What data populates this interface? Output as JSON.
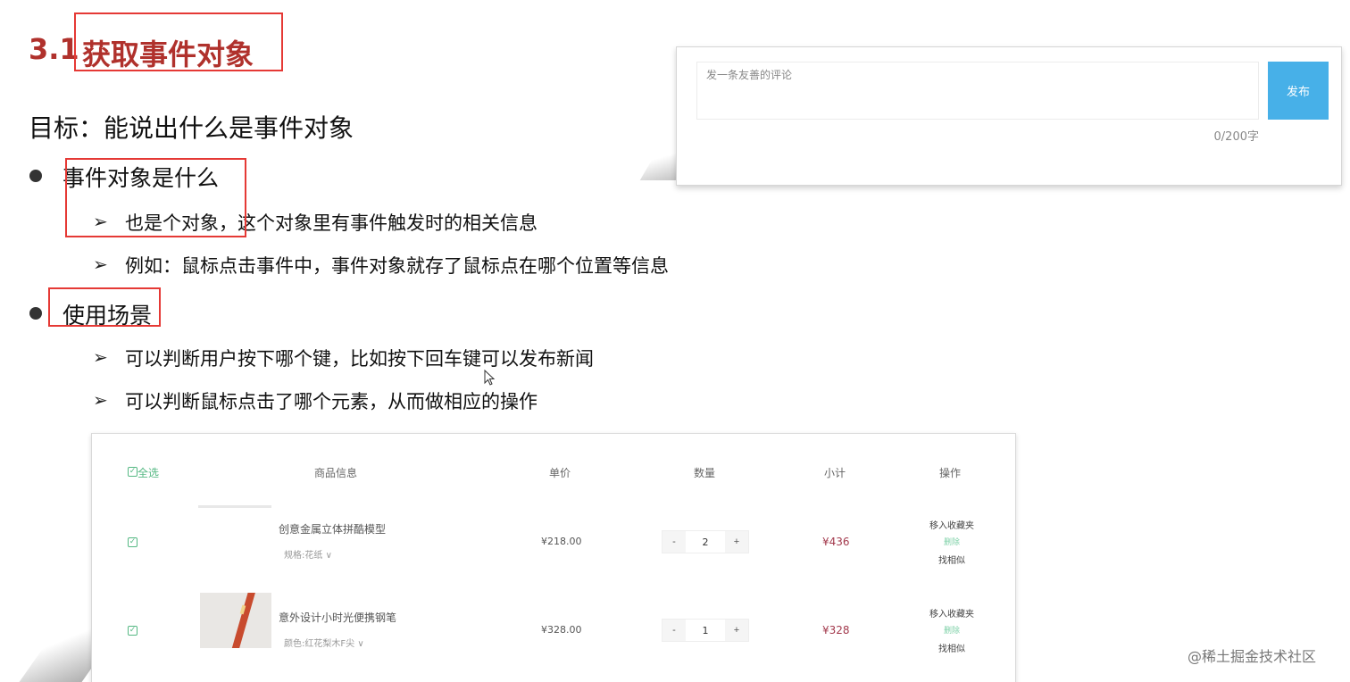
{
  "slide": {
    "title_number": "3.1",
    "title_text": "获取事件对象",
    "goal": "目标：能说出什么是事件对象",
    "bullets": [
      {
        "label": "事件对象是什么",
        "subs": [
          "也是个对象，这个对象里有事件触发时的相关信息",
          "例如：鼠标点击事件中，事件对象就存了鼠标点在哪个位置等信息"
        ]
      },
      {
        "label": "使用场景",
        "subs": [
          "可以判断用户按下哪个键，比如按下回车键可以发布新闻",
          "可以判断鼠标点击了哪个元素，从而做相应的操作"
        ]
      }
    ],
    "arrow_glyph": "➢",
    "highlight_color": "#e53935",
    "title_color": "#b0312c"
  },
  "comment_widget": {
    "placeholder": "发一条友善的评论",
    "publish_label": "发布",
    "counter": "0/200字",
    "button_color": "#47b0e8"
  },
  "cart": {
    "headers": {
      "select_all": "全选",
      "product": "商品信息",
      "unit_price": "单价",
      "quantity": "数量",
      "subtotal": "小计",
      "actions": "操作"
    },
    "rows": [
      {
        "name": "创意金属立体拼酷模型",
        "spec": "规格:花纸",
        "price": "¥218.00",
        "qty": "2",
        "subtotal": "¥436",
        "action_fav": "移入收藏夹",
        "action_del": "删除",
        "action_similar": "找相似"
      },
      {
        "name": "意外设计小时光便携钢笔",
        "spec": "颜色:红花梨木F尖",
        "price": "¥328.00",
        "qty": "1",
        "subtotal": "¥328",
        "action_fav": "移入收藏夹",
        "action_del": "删除",
        "action_similar": "找相似"
      }
    ],
    "minus": "-",
    "plus": "+",
    "checkmark": "✓",
    "chevron": "∨"
  },
  "watermark": "@稀土掘金技术社区"
}
